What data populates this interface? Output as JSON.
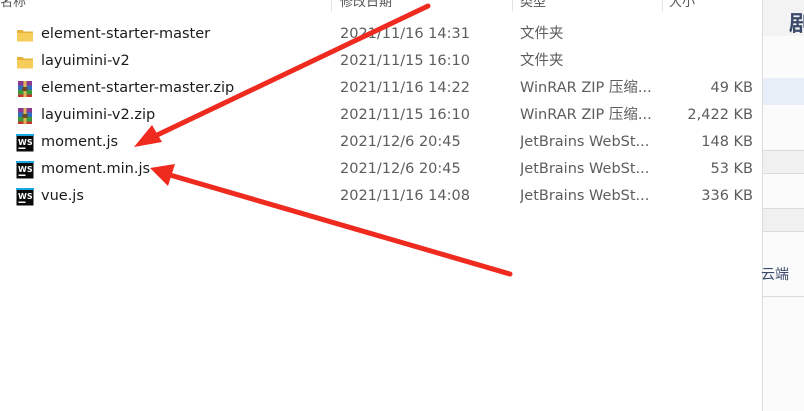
{
  "columns": {
    "name": "名称",
    "date": "修改日期",
    "type": "类型",
    "size": "大小"
  },
  "files": [
    {
      "name": "element-starter-master",
      "date": "2021/11/16 14:31",
      "type": "文件夹",
      "size": "",
      "icon": "folder-icon"
    },
    {
      "name": "layuimini-v2",
      "date": "2021/11/15 16:10",
      "type": "文件夹",
      "size": "",
      "icon": "folder-icon"
    },
    {
      "name": "element-starter-master.zip",
      "date": "2021/11/16 14:22",
      "type": "WinRAR ZIP 压缩...",
      "size": "49 KB",
      "icon": "winrar-archive-icon"
    },
    {
      "name": "layuimini-v2.zip",
      "date": "2021/11/15 16:10",
      "type": "WinRAR ZIP 压缩...",
      "size": "2,422 KB",
      "icon": "winrar-archive-icon"
    },
    {
      "name": "moment.js",
      "date": "2021/12/6 20:45",
      "type": "JetBrains WebSt...",
      "size": "148 KB",
      "icon": "webstorm-file-icon"
    },
    {
      "name": "moment.min.js",
      "date": "2021/12/6 20:45",
      "type": "JetBrains WebSt...",
      "size": "53 KB",
      "icon": "webstorm-file-icon"
    },
    {
      "name": "vue.js",
      "date": "2021/11/16 14:08",
      "type": "JetBrains WebSt...",
      "size": "336 KB",
      "icon": "webstorm-file-icon"
    }
  ],
  "right_panel": {
    "partial_text_top": "剧",
    "partial_text_mid": "云端"
  },
  "colors": {
    "arrow": "#ef2a1f",
    "folder": "#f1c24a",
    "webstorm": "#0a0a0a",
    "panel_accent": "#e8eef7"
  }
}
